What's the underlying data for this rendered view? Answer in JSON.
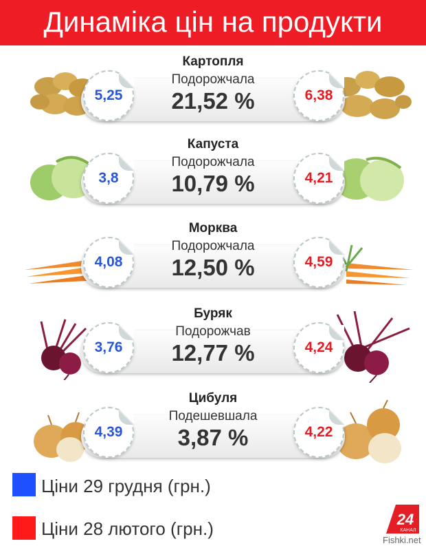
{
  "title": "Динаміка цін на продукти",
  "rows": [
    {
      "name": "Картопля",
      "verb": "Подорожчала",
      "percent": "21,52 %",
      "price_dec": "5,25",
      "price_feb": "6,38",
      "vegetable": "potato"
    },
    {
      "name": "Капуста",
      "verb": "Подорожчала",
      "percent": "10,79 %",
      "price_dec": "3,8",
      "price_feb": "4,21",
      "vegetable": "cabbage"
    },
    {
      "name": "Морква",
      "verb": "Подорожчала",
      "percent": "12,50 %",
      "price_dec": "4,08",
      "price_feb": "4,59",
      "vegetable": "carrot"
    },
    {
      "name": "Буряк",
      "verb": "Подорожчав",
      "percent": "12,77 %",
      "price_dec": "3,76",
      "price_feb": "4,24",
      "vegetable": "beet"
    },
    {
      "name": "Цибуля",
      "verb": "Подешевшала",
      "percent": "3,87 %",
      "price_dec": "4,39",
      "price_feb": "4,22",
      "vegetable": "onion"
    }
  ],
  "legend": [
    {
      "label": "Ціни 29 грудня (грн.)",
      "color": "#1e50ff"
    },
    {
      "label": "Ціни 28 лютого (грн.)",
      "color": "#ff1a1a"
    }
  ],
  "logo": {
    "number": "24",
    "caption": "КАНАЛ"
  },
  "watermark": "Fishki.net",
  "colors": {
    "banner": "#ee1c25",
    "price_dec": "#2956d6",
    "price_feb": "#e51c23"
  }
}
